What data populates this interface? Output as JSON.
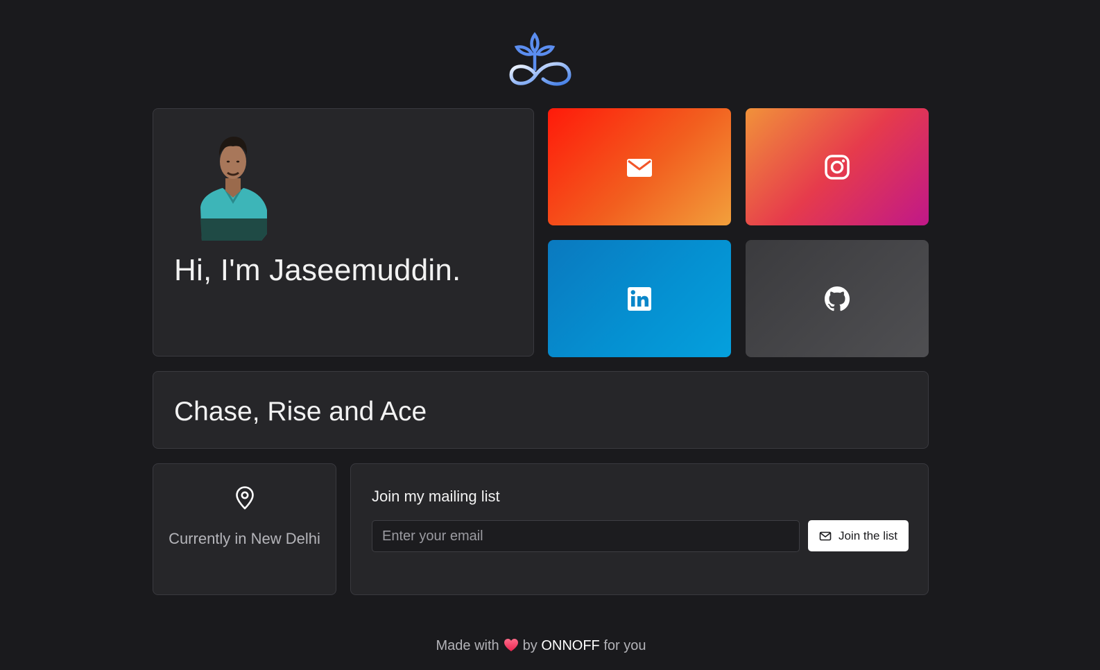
{
  "logo": {
    "icon": "infinity-plant-logo",
    "colors": [
      "#5b8def",
      "#ffffff"
    ]
  },
  "profile": {
    "avatar_icon": "profile-photo",
    "greeting": "Hi, I'm Jaseemuddin."
  },
  "social": [
    {
      "name": "email",
      "icon": "mail-icon",
      "colors": [
        "#ff1a0a",
        "#f2a03c"
      ]
    },
    {
      "name": "instagram",
      "icon": "instagram-icon",
      "colors": [
        "#f1923a",
        "#c01889"
      ]
    },
    {
      "name": "linkedin",
      "icon": "linkedin-icon",
      "colors": [
        "#0a79bf",
        "#05a0dd"
      ]
    },
    {
      "name": "github",
      "icon": "github-icon",
      "colors": [
        "#3b3b3e",
        "#4f4f52"
      ]
    }
  ],
  "tagline": "Chase, Rise and Ace",
  "location": {
    "icon": "map-pin-icon",
    "text": "Currently in New Delhi"
  },
  "mailing": {
    "title": "Join my mailing list",
    "placeholder": "Enter your email",
    "value": "",
    "button_label": "Join the list",
    "button_icon": "mail-icon"
  },
  "footer": {
    "prefix": "Made with",
    "heart_icon": "heart-icon",
    "by": "by",
    "brand": "ONNOFF",
    "suffix": "for you"
  }
}
